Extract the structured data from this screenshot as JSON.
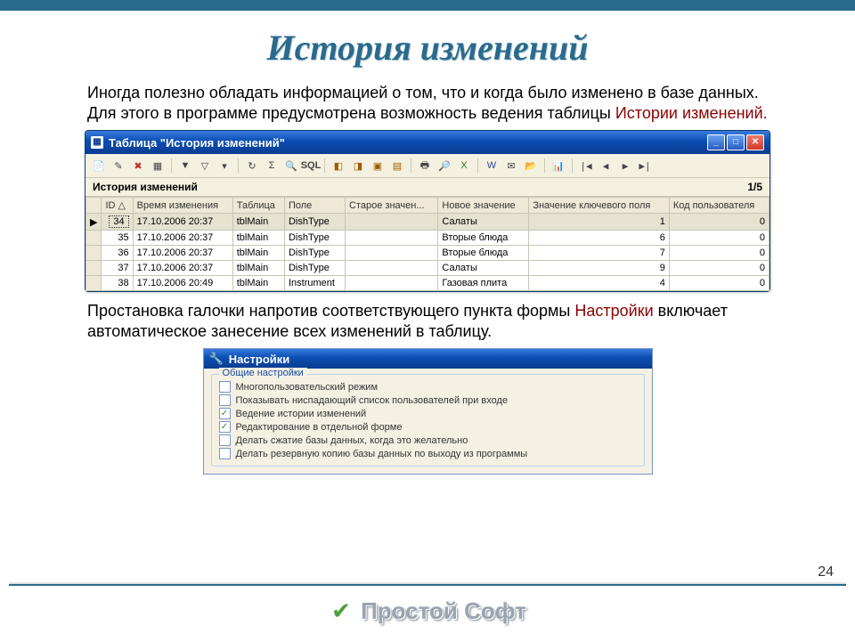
{
  "slide": {
    "title": "История изменений",
    "desc_prefix": "Иногда полезно обладать информацией о том, что и когда было изменено в базе данных. Для этого в программе предусмотрена возможность ведения таблицы ",
    "desc_red": "Истории изменений.",
    "desc2_prefix": "Простановка галочки напротив соответствующего пункта формы ",
    "desc2_red": "Настройки",
    "desc2_suffix": " включает автоматическое занесение всех изменений в таблицу.",
    "page_number": "24"
  },
  "window": {
    "title": "Таблица \"История изменений\"",
    "info_label": "История изменений",
    "info_count": "1/5",
    "headers": [
      "ID △",
      "Время изменения",
      "Таблица",
      "Поле",
      "Старое значен...",
      "Новое значение",
      "Значение ключевого поля",
      "Код пользователя"
    ],
    "rows": [
      {
        "sel": true,
        "id": "34",
        "time": "17.10.2006 20:37",
        "table": "tblMain",
        "field": "DishType",
        "old": "",
        "new": "Салаты",
        "key": "1",
        "user": "0"
      },
      {
        "sel": false,
        "id": "35",
        "time": "17.10.2006 20:37",
        "table": "tblMain",
        "field": "DishType",
        "old": "",
        "new": "Вторые блюда",
        "key": "6",
        "user": "0"
      },
      {
        "sel": false,
        "id": "36",
        "time": "17.10.2006 20:37",
        "table": "tblMain",
        "field": "DishType",
        "old": "",
        "new": "Вторые блюда",
        "key": "7",
        "user": "0"
      },
      {
        "sel": false,
        "id": "37",
        "time": "17.10.2006 20:37",
        "table": "tblMain",
        "field": "DishType",
        "old": "",
        "new": "Салаты",
        "key": "9",
        "user": "0"
      },
      {
        "sel": false,
        "id": "38",
        "time": "17.10.2006 20:49",
        "table": "tblMain",
        "field": "Instrument",
        "old": "",
        "new": "Газовая плита",
        "key": "4",
        "user": "0"
      }
    ]
  },
  "settings": {
    "title": "Настройки",
    "group": "Общие настройки",
    "options": [
      {
        "label": "Многопользовательский режим",
        "checked": false,
        "circled": false
      },
      {
        "label": "Показывать ниспадающий список пользователей при входе",
        "checked": false,
        "circled": false
      },
      {
        "label": "Ведение истории изменений",
        "checked": true,
        "circled": true
      },
      {
        "label": "Редактирование в отдельной форме",
        "checked": true,
        "circled": false
      },
      {
        "label": "Делать сжатие базы данных, когда это желательно",
        "checked": false,
        "circled": false
      },
      {
        "label": "Делать резервную копию базы данных по выходу из программы",
        "checked": false,
        "circled": false
      }
    ]
  },
  "footer": {
    "brand": "Простой Софт"
  }
}
